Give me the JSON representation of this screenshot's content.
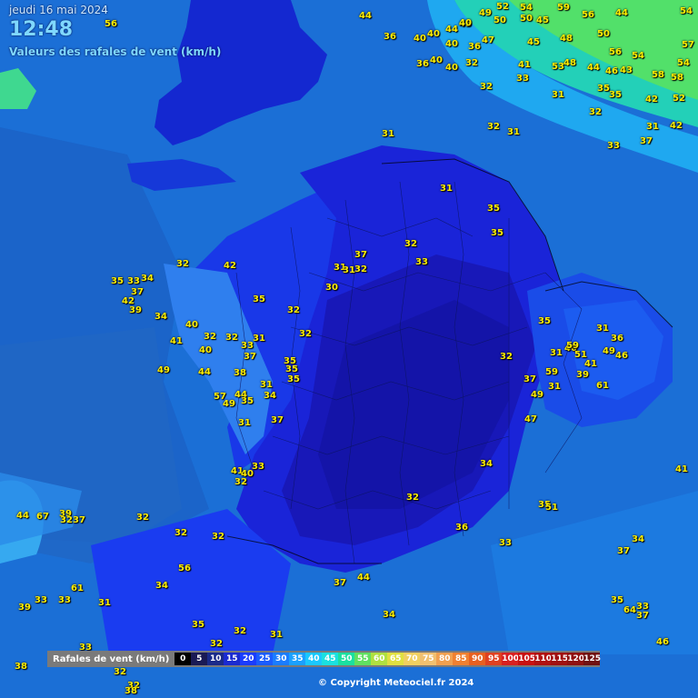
{
  "header": {
    "date": "jeudi 16 mai 2024",
    "time": "12:48",
    "subtitle": "Valeurs des rafales de vent (km/h)"
  },
  "legend": {
    "title": "Rafales de vent (km/h)",
    "steps": [
      {
        "label": "0",
        "color": "#000000"
      },
      {
        "label": "5",
        "color": "#1a1a55"
      },
      {
        "label": "10",
        "color": "#1a2a8a"
      },
      {
        "label": "15",
        "color": "#1a2ad0"
      },
      {
        "label": "20",
        "color": "#1a3cff"
      },
      {
        "label": "25",
        "color": "#1a5cff"
      },
      {
        "label": "30",
        "color": "#1a7cff"
      },
      {
        "label": "35",
        "color": "#1aa0ff"
      },
      {
        "label": "40",
        "color": "#1ac8ff"
      },
      {
        "label": "45",
        "color": "#1ae0e0"
      },
      {
        "label": "50",
        "color": "#1ae0a0"
      },
      {
        "label": "55",
        "color": "#60e060"
      },
      {
        "label": "60",
        "color": "#b0e040"
      },
      {
        "label": "65",
        "color": "#e0e040"
      },
      {
        "label": "70",
        "color": "#f0d060"
      },
      {
        "label": "75",
        "color": "#f0c070"
      },
      {
        "label": "80",
        "color": "#f0a050"
      },
      {
        "label": "85",
        "color": "#f08030"
      },
      {
        "label": "90",
        "color": "#e86020"
      },
      {
        "label": "95",
        "color": "#e04020"
      },
      {
        "label": "100",
        "color": "#d82020"
      },
      {
        "label": "105",
        "color": "#c81010"
      },
      {
        "label": "110",
        "color": "#b01010"
      },
      {
        "label": "115",
        "color": "#a01010"
      },
      {
        "label": "120",
        "color": "#901010"
      },
      {
        "label": "125",
        "color": "#701010"
      }
    ]
  },
  "copyright": "© Copyright Meteociel.fr 2024",
  "stations": [
    {
      "v": "56"
    },
    {
      "v": "44"
    },
    {
      "v": "36"
    },
    {
      "v": "40"
    },
    {
      "v": "40"
    },
    {
      "v": "44"
    },
    {
      "v": "40"
    },
    {
      "v": "36"
    },
    {
      "v": "45"
    },
    {
      "v": "49"
    },
    {
      "v": "50"
    },
    {
      "v": "52"
    },
    {
      "v": "54"
    },
    {
      "v": "50"
    },
    {
      "v": "45"
    },
    {
      "v": "59"
    },
    {
      "v": "56"
    },
    {
      "v": "44"
    },
    {
      "v": "54"
    },
    {
      "v": "40"
    },
    {
      "v": "47"
    },
    {
      "v": "36"
    },
    {
      "v": "40"
    },
    {
      "v": "40"
    },
    {
      "v": "32"
    },
    {
      "v": "45"
    },
    {
      "v": "48"
    },
    {
      "v": "50"
    },
    {
      "v": "56"
    },
    {
      "v": "54"
    },
    {
      "v": "33"
    },
    {
      "v": "41"
    },
    {
      "v": "53"
    },
    {
      "v": "48"
    },
    {
      "v": "44"
    },
    {
      "v": "46"
    },
    {
      "v": "43"
    },
    {
      "v": "58"
    },
    {
      "v": "58"
    },
    {
      "v": "54"
    },
    {
      "v": "57"
    },
    {
      "v": "32"
    },
    {
      "v": "31"
    },
    {
      "v": "35"
    },
    {
      "v": "35"
    },
    {
      "v": "42"
    },
    {
      "v": "52"
    },
    {
      "v": "32"
    },
    {
      "v": "32"
    },
    {
      "v": "31"
    },
    {
      "v": "33"
    },
    {
      "v": "37"
    },
    {
      "v": "31"
    },
    {
      "v": "42"
    },
    {
      "v": "31"
    },
    {
      "v": "31"
    },
    {
      "v": "35"
    },
    {
      "v": "35"
    },
    {
      "v": "32"
    },
    {
      "v": "33"
    },
    {
      "v": "31"
    },
    {
      "v": "37"
    },
    {
      "v": "32"
    },
    {
      "v": "31"
    },
    {
      "v": "30"
    },
    {
      "v": "42"
    },
    {
      "v": "32"
    },
    {
      "v": "35"
    },
    {
      "v": "34"
    },
    {
      "v": "37"
    },
    {
      "v": "42"
    },
    {
      "v": "39"
    },
    {
      "v": "35"
    },
    {
      "v": "33"
    },
    {
      "v": "34"
    },
    {
      "v": "40"
    },
    {
      "v": "41"
    },
    {
      "v": "32"
    },
    {
      "v": "32"
    },
    {
      "v": "33"
    },
    {
      "v": "31"
    },
    {
      "v": "32"
    },
    {
      "v": "35"
    },
    {
      "v": "40"
    },
    {
      "v": "37"
    },
    {
      "v": "32"
    },
    {
      "v": "35"
    },
    {
      "v": "49"
    },
    {
      "v": "44"
    },
    {
      "v": "38"
    },
    {
      "v": "31"
    },
    {
      "v": "35"
    },
    {
      "v": "57"
    },
    {
      "v": "44"
    },
    {
      "v": "49"
    },
    {
      "v": "35"
    },
    {
      "v": "34"
    },
    {
      "v": "31"
    },
    {
      "v": "37"
    },
    {
      "v": "35"
    },
    {
      "v": "32"
    },
    {
      "v": "31"
    },
    {
      "v": "40"
    },
    {
      "v": "36"
    },
    {
      "v": "31"
    },
    {
      "v": "59"
    },
    {
      "v": "51"
    },
    {
      "v": "49"
    },
    {
      "v": "46"
    },
    {
      "v": "59"
    },
    {
      "v": "41"
    },
    {
      "v": "37"
    },
    {
      "v": "49"
    },
    {
      "v": "31"
    },
    {
      "v": "39"
    },
    {
      "v": "61"
    },
    {
      "v": "47"
    },
    {
      "v": "41"
    },
    {
      "v": "40"
    },
    {
      "v": "33"
    },
    {
      "v": "32"
    },
    {
      "v": "34"
    },
    {
      "v": "32"
    },
    {
      "v": "35"
    },
    {
      "v": "51"
    },
    {
      "v": "41"
    },
    {
      "v": "44"
    },
    {
      "v": "67"
    },
    {
      "v": "39"
    },
    {
      "v": "32"
    },
    {
      "v": "37"
    },
    {
      "v": "32"
    },
    {
      "v": "32"
    },
    {
      "v": "32"
    },
    {
      "v": "36"
    },
    {
      "v": "33"
    },
    {
      "v": "56"
    },
    {
      "v": "34"
    },
    {
      "v": "61"
    },
    {
      "v": "31"
    },
    {
      "v": "39"
    },
    {
      "v": "33"
    },
    {
      "v": "33"
    },
    {
      "v": "44"
    },
    {
      "v": "37"
    },
    {
      "v": "34"
    },
    {
      "v": "35"
    },
    {
      "v": "32"
    },
    {
      "v": "31"
    },
    {
      "v": "32"
    },
    {
      "v": "33"
    },
    {
      "v": "38"
    },
    {
      "v": "34"
    },
    {
      "v": "37"
    },
    {
      "v": "35"
    },
    {
      "v": "64"
    },
    {
      "v": "33"
    },
    {
      "v": "37"
    },
    {
      "v": "46"
    },
    {
      "v": "32"
    },
    {
      "v": "32"
    },
    {
      "v": "38"
    }
  ]
}
